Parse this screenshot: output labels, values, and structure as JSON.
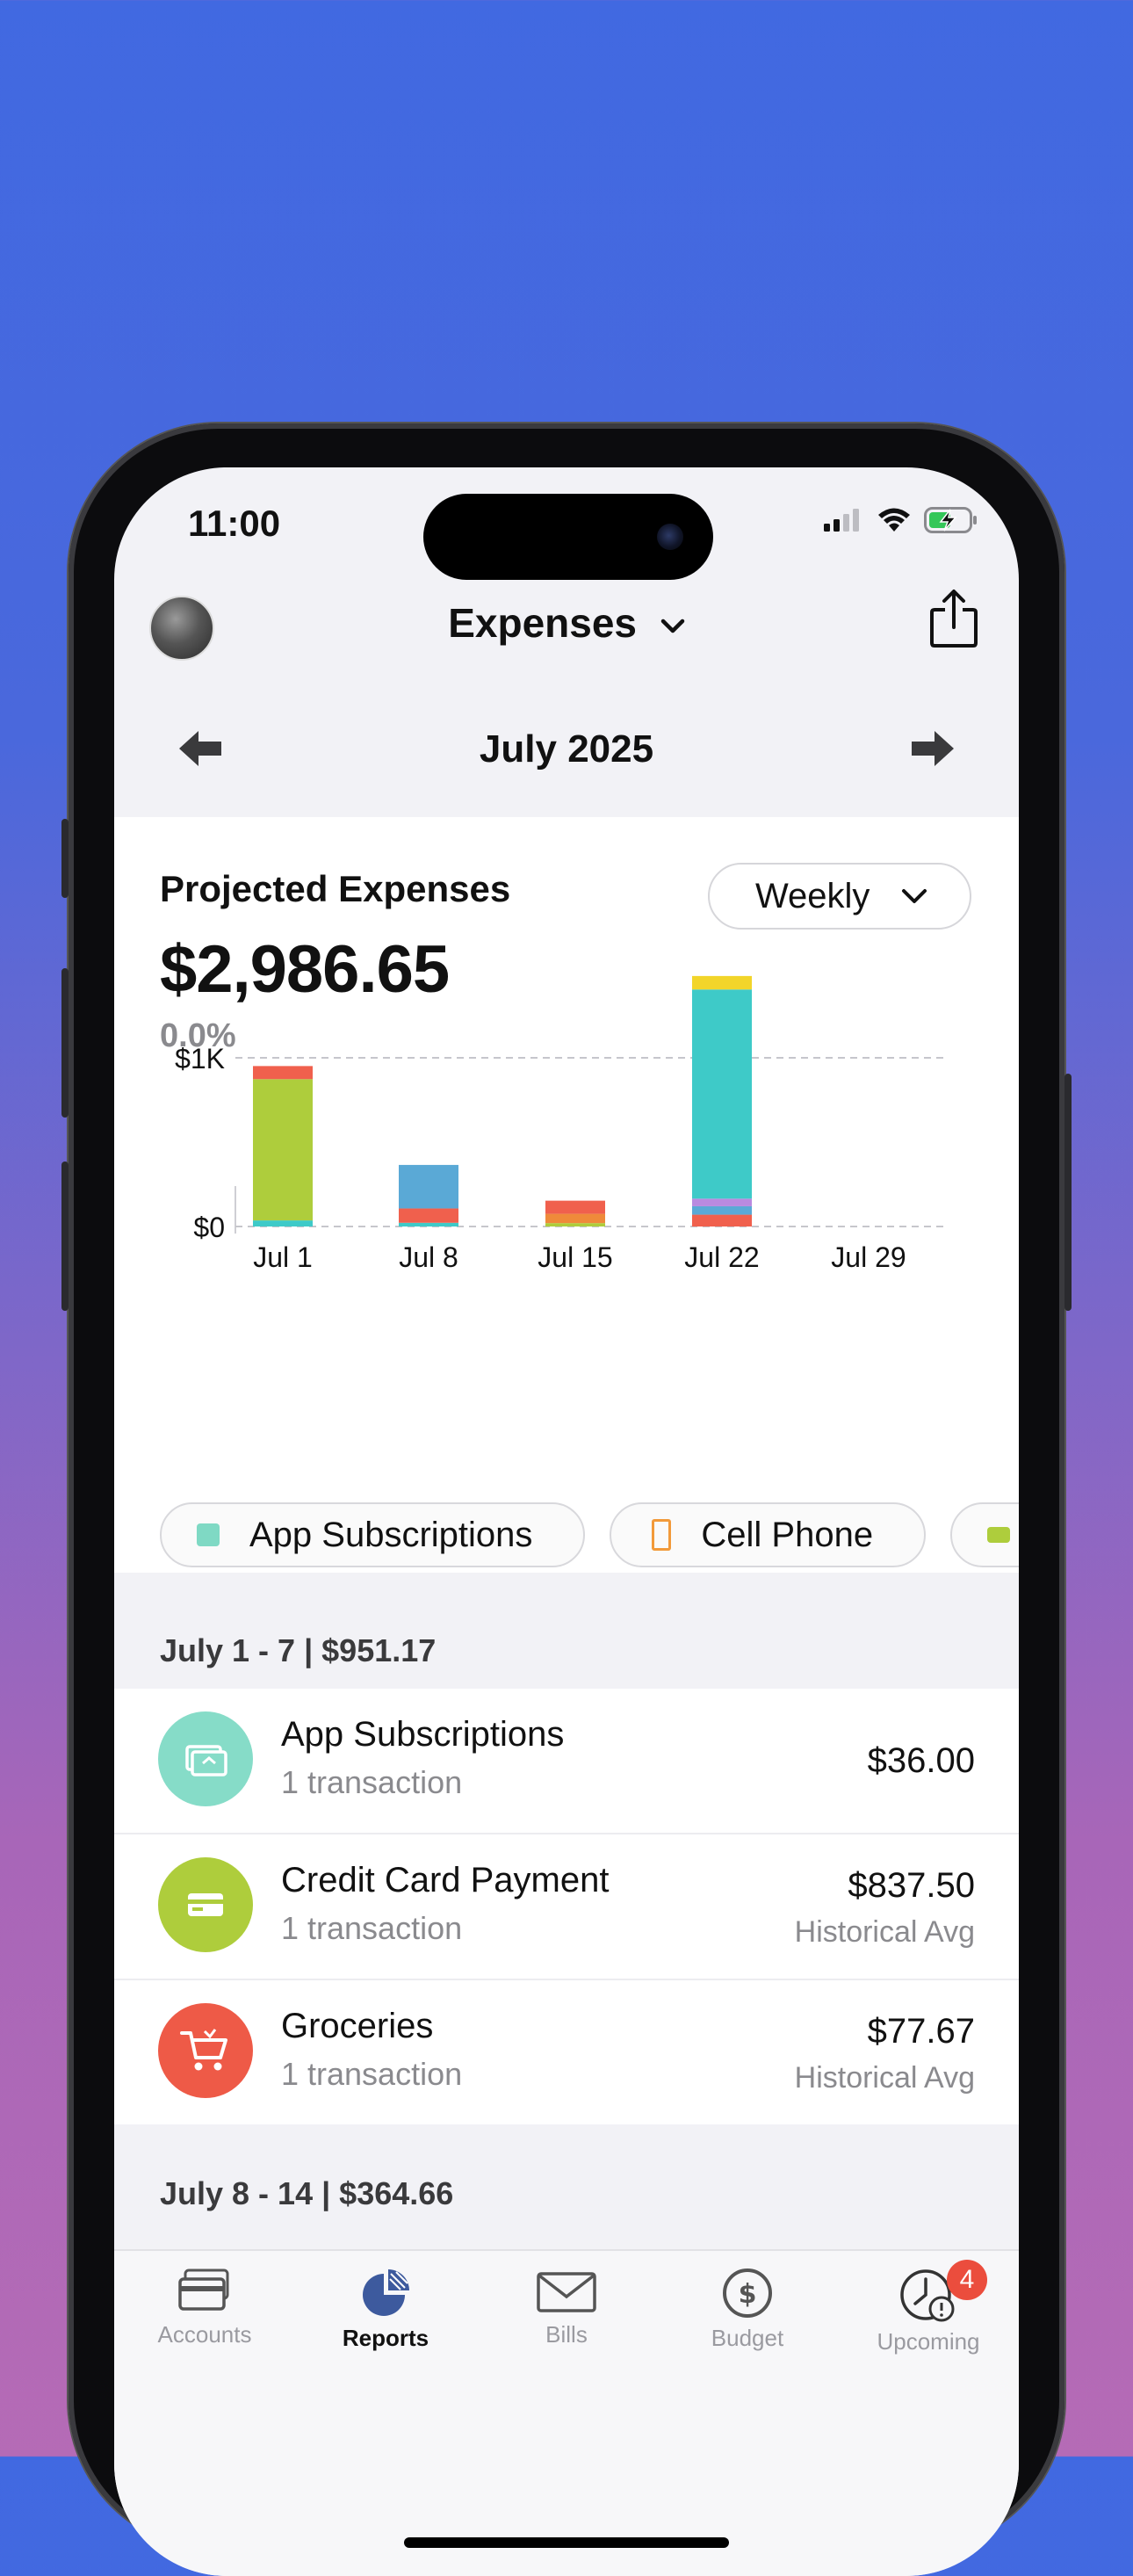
{
  "status": {
    "time": "11:00"
  },
  "header": {
    "title": "Expenses",
    "month": "July 2025"
  },
  "summary": {
    "title": "Projected Expenses",
    "amount": "$2,986.65",
    "change": "0.0%",
    "period_select": "Weekly"
  },
  "chart_data": {
    "type": "bar",
    "stacked": true,
    "categories": [
      "Jul 1",
      "Jul 8",
      "Jul 15",
      "Jul 22",
      "Jul 29"
    ],
    "y_ticks": [
      "$0",
      "$1K"
    ],
    "ylim": [
      0,
      1650
    ],
    "grid": "dashed at $1K",
    "series": [
      {
        "color": "#f0604d",
        "values": [
          0,
          0,
          0,
          70,
          0
        ]
      },
      {
        "color": "#5aa9d6",
        "values": [
          0,
          0,
          0,
          50,
          0
        ]
      },
      {
        "color": "#b98ae0",
        "values": [
          0,
          0,
          0,
          45,
          0
        ]
      },
      {
        "color": "#3ecac8",
        "values": [
          36,
          22,
          0,
          1240,
          0
        ]
      },
      {
        "color": "#aecd3c",
        "values": [
          837.5,
          0,
          20,
          0,
          0
        ]
      },
      {
        "color": "#f0604d",
        "values": [
          77.67,
          85,
          0,
          0,
          0
        ]
      },
      {
        "color": "#ef8a3a",
        "values": [
          0,
          0,
          55,
          0,
          0
        ]
      },
      {
        "color": "#5aa9d6",
        "values": [
          0,
          258,
          0,
          0,
          0
        ]
      },
      {
        "color": "#f0604d",
        "values": [
          0,
          0,
          78,
          0,
          0
        ]
      },
      {
        "color": "#f2d52a",
        "values": [
          0,
          0,
          0,
          80,
          0
        ]
      }
    ]
  },
  "chips": [
    {
      "label": "App Subscriptions",
      "color": "#7fd9c4"
    },
    {
      "label": "Cell Phone",
      "color": "#f29a3a"
    },
    {
      "label": "",
      "color": "#aecd3c"
    }
  ],
  "weeks": [
    {
      "header": "July 1 - 7   |   $951.17"
    },
    {
      "header": "July 8 - 14   |   $364.66"
    }
  ],
  "rows": [
    {
      "name": "App Subscriptions",
      "sub": "1 transaction",
      "amount": "$36.00",
      "note": "",
      "color": "#86dcc8",
      "icon": "subscription-icon"
    },
    {
      "name": "Credit Card Payment",
      "sub": "1 transaction",
      "amount": "$837.50",
      "note": "Historical Avg",
      "color": "#aecd3c",
      "icon": "credit-card-icon"
    },
    {
      "name": "Groceries",
      "sub": "1 transaction",
      "amount": "$77.67",
      "note": "Historical Avg",
      "color": "#ee5a47",
      "icon": "cart-icon"
    }
  ],
  "tabs": [
    {
      "label": "Accounts",
      "icon": "accounts-icon"
    },
    {
      "label": "Reports",
      "icon": "reports-pie-icon"
    },
    {
      "label": "Bills",
      "icon": "bills-envelope-icon"
    },
    {
      "label": "Budget",
      "icon": "budget-dollar-icon"
    },
    {
      "label": "Upcoming",
      "icon": "upcoming-clock-icon",
      "badge": "4"
    }
  ],
  "active_tab": "Reports"
}
